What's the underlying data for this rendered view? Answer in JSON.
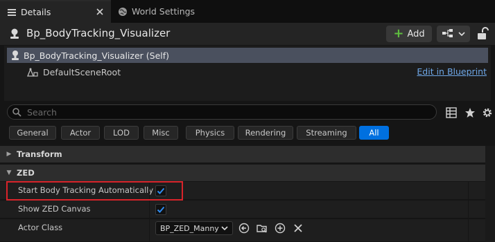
{
  "tabs": [
    {
      "label": "Details",
      "icon": "list-icon",
      "active": true
    },
    {
      "label": "World Settings",
      "icon": "globe-icon",
      "active": false
    }
  ],
  "header": {
    "actor_name": "Bp_BodyTracking_Visualizer",
    "add_label": "Add"
  },
  "tree": {
    "self_label": "Bp_BodyTracking_Visualizer (Self)",
    "root_label": "DefaultSceneRoot",
    "edit_link": "Edit in Blueprint"
  },
  "search": {
    "placeholder": "Search"
  },
  "filters": [
    {
      "label": "General",
      "active": false
    },
    {
      "label": "Actor",
      "active": false
    },
    {
      "label": "LOD",
      "active": false
    },
    {
      "label": "Misc",
      "active": false
    },
    {
      "label": "Physics",
      "active": false
    },
    {
      "label": "Rendering",
      "active": false
    },
    {
      "label": "Streaming",
      "active": false
    },
    {
      "label": "All",
      "active": true
    }
  ],
  "sections": {
    "transform": "Transform",
    "zed": "ZED"
  },
  "properties": {
    "start_body_tracking": {
      "label": "Start Body Tracking Automatically",
      "checked": true
    },
    "show_zed_canvas": {
      "label": "Show ZED Canvas",
      "checked": true
    },
    "actor_class": {
      "label": "Actor Class",
      "value": "BP_ZED_Manny"
    }
  },
  "colors": {
    "accent": "#0070e0",
    "highlight_border": "#d9232a",
    "add_plus": "#5fbf3f",
    "link": "#6fa8e8"
  }
}
